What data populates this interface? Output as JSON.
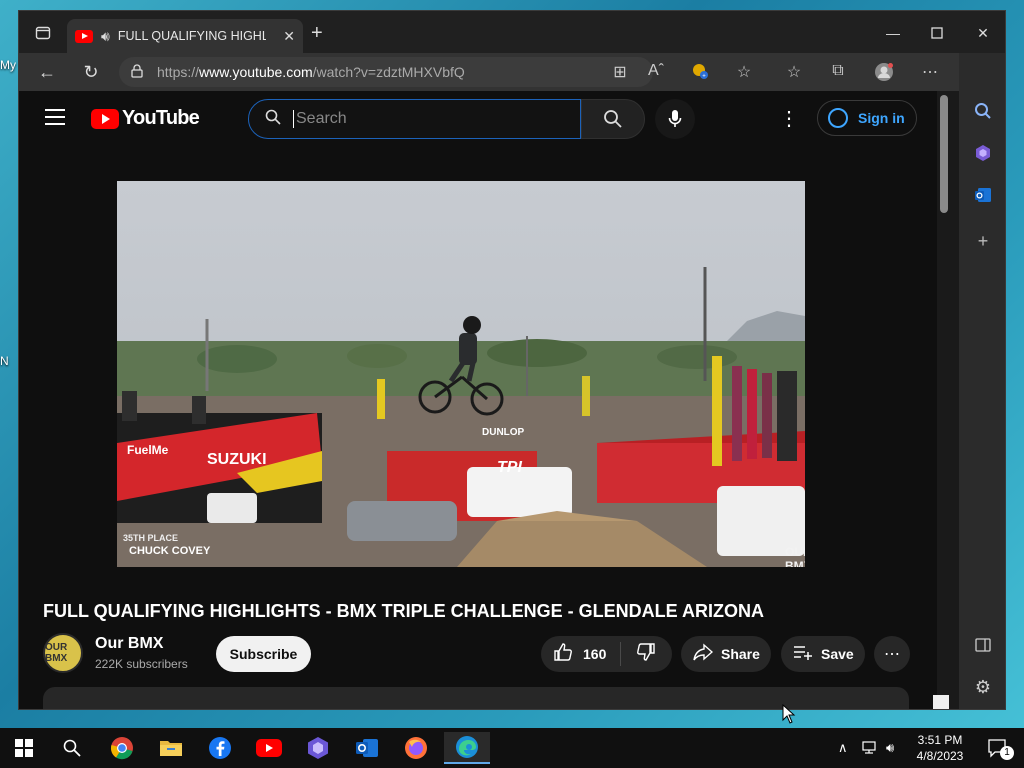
{
  "desktop": {
    "icon_labels": [
      "My",
      "N"
    ]
  },
  "browser": {
    "tab": {
      "title": "FULL QUALIFYING HIGHLIGHTS - BMX TRIPLE CHALLENGE - GLENDALE ARIZONA"
    },
    "url_prefix": "https://",
    "url_host": "www.youtube.com",
    "url_path": "/watch?v=zdztMHXVbfQ"
  },
  "youtube": {
    "logo_text": "YouTube",
    "search_placeholder": "Search",
    "signin_label": "Sign in",
    "video": {
      "overlay_place": "35TH PLACE",
      "overlay_rider": "CHUCK COVEY",
      "watermark": "OUR BMX",
      "banner_fuelme": "FuelMe",
      "banner_brand": "SUZUKI",
      "banner_tpi": "TPI",
      "banner_dunlop": "DUNLOP"
    },
    "title": "FULL QUALIFYING HIGHLIGHTS - BMX TRIPLE CHALLENGE - GLENDALE ARIZONA",
    "channel": {
      "name": "Our BMX",
      "subscribers": "222K subscribers",
      "avatar_text": "OUR BMX"
    },
    "subscribe_label": "Subscribe",
    "like_count": "160",
    "share_label": "Share",
    "save_label": "Save"
  },
  "taskbar": {
    "time": "3:51 PM",
    "date": "4/8/2023",
    "notification_count": "1"
  },
  "colors": {
    "yt_red": "#ff0000",
    "link_blue": "#3ea6ff",
    "search_focus": "#1c62b9"
  }
}
